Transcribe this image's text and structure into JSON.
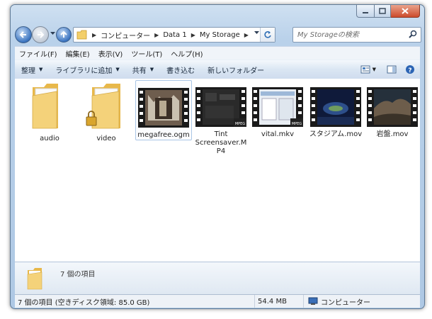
{
  "window": {
    "caption_buttons": [
      "minimize-icon",
      "maximize-icon",
      "close-icon"
    ]
  },
  "nav": {
    "back_icon": "back-arrow-icon",
    "forward_icon": "forward-arrow-icon",
    "up_icon": "up-arrow-icon"
  },
  "address": {
    "breadcrumbs": [
      {
        "label": "コンピューター"
      },
      {
        "label": "Data 1"
      },
      {
        "label": "My Storage"
      }
    ]
  },
  "search": {
    "placeholder": "My Storageの検索"
  },
  "menu": {
    "items": [
      {
        "label": "ファイル(F)"
      },
      {
        "label": "編集(E)"
      },
      {
        "label": "表示(V)"
      },
      {
        "label": "ツール(T)"
      },
      {
        "label": "ヘルプ(H)"
      }
    ]
  },
  "toolbar": {
    "organize": "整理",
    "library": "ライブラリに追加",
    "share": "共有",
    "burn": "書き込む",
    "new_folder": "新しいフォルダー"
  },
  "files": [
    {
      "name": "audio",
      "type": "folder"
    },
    {
      "name": "video",
      "type": "folder-locked"
    },
    {
      "name": "megafree.ogm",
      "type": "video",
      "selected": true
    },
    {
      "name": "Tint Screensaver.MP4",
      "type": "video",
      "badge": "MPEG"
    },
    {
      "name": "vital.mkv",
      "type": "video",
      "badge": "MPEG"
    },
    {
      "name": "スタジアム.mov",
      "type": "video"
    },
    {
      "name": "岩盤.mov",
      "type": "video"
    }
  ],
  "details": {
    "count": "7 個の項目"
  },
  "status": {
    "items": "7 個の項目 (空きディスク領域: 85.0 GB)",
    "size": "54.4 MB",
    "location": "コンピューター"
  },
  "colors": {
    "frame": "#b9d1ea",
    "selection_border": "#aac6e6",
    "folder": "#f3cf6a",
    "close_button": "#cc4b2c"
  }
}
